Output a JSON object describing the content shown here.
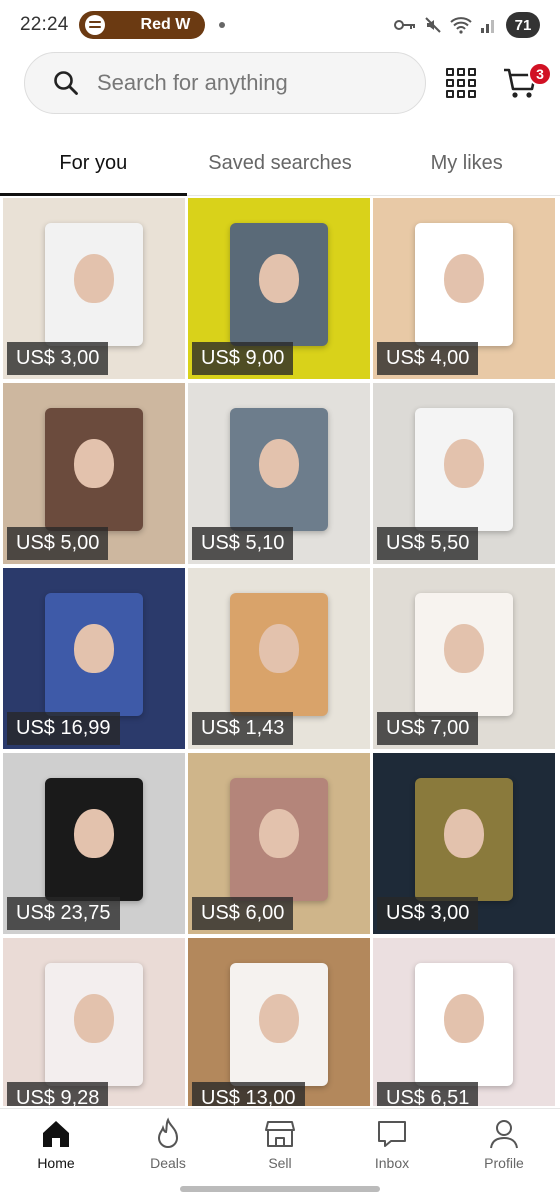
{
  "status_bar": {
    "time": "22:24",
    "media_label": "Red W",
    "battery": "71"
  },
  "search": {
    "placeholder": "Search for anything",
    "cart_count": "3"
  },
  "tabs": [
    {
      "label": "For you",
      "active": true
    },
    {
      "label": "Saved searches",
      "active": false
    },
    {
      "label": "My likes",
      "active": false
    }
  ],
  "listings": [
    {
      "price": "US$ 3,00",
      "bg": "#e9e1d6",
      "card": "#f2f2f2"
    },
    {
      "price": "US$ 9,00",
      "bg": "#d9d21a",
      "card": "#5a6a78"
    },
    {
      "price": "US$ 4,00",
      "bg": "#e8c9a6",
      "card": "#ffffff"
    },
    {
      "price": "US$ 5,00",
      "bg": "#cdb79f",
      "card": "#6b4b3d"
    },
    {
      "price": "US$ 5,10",
      "bg": "#e2e0dc",
      "card": "#6d7d8c"
    },
    {
      "price": "US$ 5,50",
      "bg": "#dcdad6",
      "card": "#f4f4f4"
    },
    {
      "price": "US$ 16,99",
      "bg": "#2b3a6b",
      "card": "#3e5aa8"
    },
    {
      "price": "US$ 1,43",
      "bg": "#e7e3da",
      "card": "#d9a36a"
    },
    {
      "price": "US$ 7,00",
      "bg": "#e0dcd5",
      "card": "#f7f3ef"
    },
    {
      "price": "US$ 23,75",
      "bg": "#cfcfcf",
      "card": "#1a1a1a"
    },
    {
      "price": "US$ 6,00",
      "bg": "#cfb58a",
      "card": "#b4857a"
    },
    {
      "price": "US$ 3,00",
      "bg": "#1e2a38",
      "card": "#8a7a3c"
    },
    {
      "price": "US$ 9,28",
      "bg": "#eadbd6",
      "card": "#f3eeee"
    },
    {
      "price": "US$ 13,00",
      "bg": "#b3885c",
      "card": "#f5f2ef"
    },
    {
      "price": "US$ 6,51",
      "bg": "#ebdfe0",
      "card": "#ffffff"
    }
  ],
  "nav": [
    {
      "label": "Home",
      "active": true
    },
    {
      "label": "Deals",
      "active": false
    },
    {
      "label": "Sell",
      "active": false
    },
    {
      "label": "Inbox",
      "active": false
    },
    {
      "label": "Profile",
      "active": false
    }
  ],
  "colors": {
    "accent": "#d11124",
    "media_pill": "#6b3a12"
  }
}
